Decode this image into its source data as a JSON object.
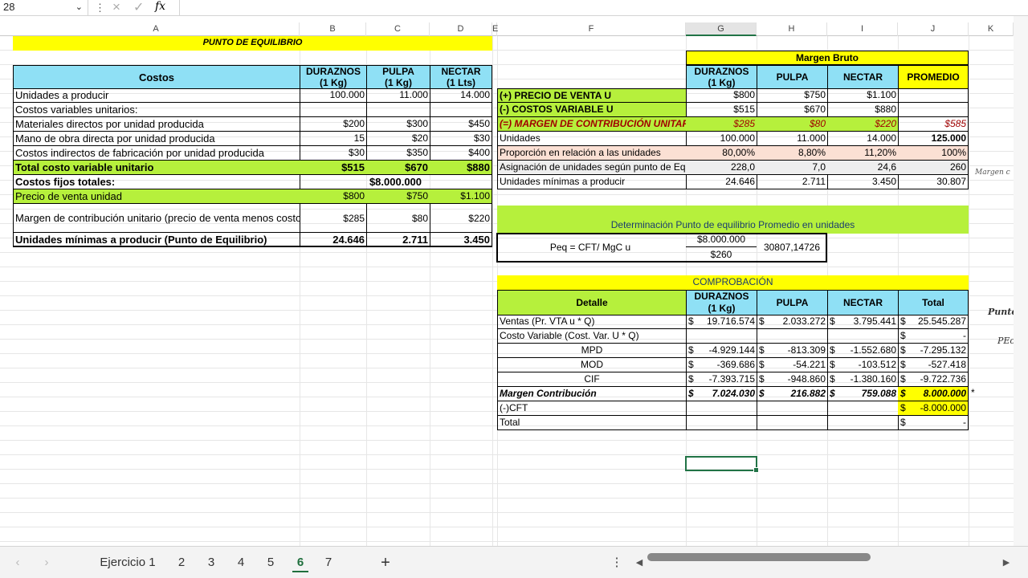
{
  "formula_bar": {
    "name_box": "28",
    "fx": "fx"
  },
  "columns": [
    "A",
    "B",
    "C",
    "D",
    "E",
    "F",
    "G",
    "H",
    "I",
    "J",
    "K"
  ],
  "left": {
    "title": "PUNTO DE EQUILIBRIO",
    "hdr": {
      "costos": "Costos",
      "d1": "DURAZNOS",
      "d2": "(1 Kg)",
      "p1": "PULPA",
      "p2": "(1 Kg)",
      "n1": "NECTAR",
      "n2": "(1 Lts)"
    },
    "rows": [
      {
        "l": "Unidades a producir",
        "b": "100.000",
        "c": "11.000",
        "d": "14.000"
      },
      {
        "l": "Costos variables unitarios:",
        "b": "",
        "c": "",
        "d": ""
      },
      {
        "l": "Materiales directos por unidad producida",
        "b": "$200",
        "c": "$300",
        "d": "$450"
      },
      {
        "l": "Mano de obra directa por unidad producida",
        "b": "15",
        "c": "$20",
        "d": "$30"
      },
      {
        "l": "Costos indirectos de fabricación por unidad producida",
        "b": "$30",
        "c": "$350",
        "d": "$400"
      },
      {
        "l": "Total costo variable unitario",
        "b": "$515",
        "c": "$670",
        "d": "$880"
      }
    ],
    "fijos_label": "Costos fijos totales:",
    "fijos_val": "$8.000.000",
    "precio": {
      "l": "Precio de venta unidad",
      "b": "$800",
      "c": "$750",
      "d": "$1.100"
    },
    "margen": {
      "l": "Margen de contribución unitario (precio de venta menos costo variable)",
      "b": "$285",
      "c": "$80",
      "d": "$220"
    },
    "minimas": {
      "l": "Unidades mínimas a producir (Punto de Equilibrio)",
      "b": "24.646",
      "c": "2.711",
      "d": "3.450"
    }
  },
  "right": {
    "title": "Margen Bruto",
    "hdr": {
      "d1": "DURAZNOS",
      "d2": "(1 Kg)",
      "p": "PULPA",
      "n": "NECTAR",
      "prom": "PROMEDIO"
    },
    "rows": [
      {
        "l": "(+) PRECIO DE VENTA U",
        "g": "$800",
        "h": "$750",
        "i": "$1.100",
        "j": ""
      },
      {
        "l": "(-) COSTOS VARIABLE U",
        "g": "$515",
        "h": "$670",
        "i": "$880",
        "j": ""
      },
      {
        "l": "(=) MARGEN DE CONTRIBUCIÓN UNITARIO",
        "g": "$285",
        "h": "$80",
        "i": "$220",
        "j": "$585"
      },
      {
        "l": "Unidades",
        "g": "100.000",
        "h": "11.000",
        "i": "14.000",
        "j": "125.000"
      },
      {
        "l": "Proporción en relación a las unidades",
        "g": "80,00%",
        "h": "8,80%",
        "i": "11,20%",
        "j": "100%"
      },
      {
        "l": "Asignación de unidades según punto de Equilibrio",
        "g": "228,0",
        "h": "7,0",
        "i": "24,6",
        "j": "260"
      },
      {
        "l": "Unidades mínimas a producir",
        "g": "24.646",
        "h": "2.711",
        "i": "3.450",
        "j": "30.807"
      }
    ],
    "side_note": "Margen c",
    "det_title": "Determinación Punto de equilibrio Promedio en unidades",
    "peq_label": "Peq = CFT/ MgC u",
    "peq_num": "$8.000.000",
    "peq_den": "$260",
    "peq_res": "30807,14726"
  },
  "comprobacion": {
    "title": "COMPROBACIÓN",
    "hdr": {
      "det": "Detalle",
      "d1": "DURAZNOS",
      "d2": "(1 Kg)",
      "p": "PULPA",
      "n": "NECTAR",
      "t": "Total"
    },
    "cur": "$",
    "rows": [
      {
        "l": "Ventas (Pr. VTA u * Q)",
        "g": "19.716.574",
        "h": "2.033.272",
        "i": "3.795.441",
        "j": "25.545.287"
      },
      {
        "l": "Costo Variable  (Cost. Var. U * Q)",
        "g": "",
        "h": "",
        "i": "",
        "j": "-"
      },
      {
        "l": "MPD",
        "g": "-4.929.144",
        "h": "-813.309",
        "i": "-1.552.680",
        "j": "-7.295.132"
      },
      {
        "l": "MOD",
        "g": "-369.686",
        "h": "-54.221",
        "i": "-103.512",
        "j": "-527.418"
      },
      {
        "l": "CIF",
        "g": "-7.393.715",
        "h": "-948.860",
        "i": "-1.380.160",
        "j": "-9.722.736"
      },
      {
        "l": "Margen Contribución",
        "g": "7.024.030",
        "h": "216.882",
        "i": "759.088",
        "j": "8.000.000"
      },
      {
        "l": "(-)CFT",
        "g": "",
        "h": "",
        "i": "",
        "j": "-8.000.000"
      },
      {
        "l": "Total",
        "g": "",
        "h": "",
        "i": "",
        "j": "-"
      }
    ],
    "star": "*",
    "note1": "Punto",
    "note2": "PEc"
  },
  "tabs": [
    "Ejercicio 1",
    "2",
    "3",
    "4",
    "5",
    "6",
    "7"
  ],
  "active_tab": "6",
  "add": "+"
}
